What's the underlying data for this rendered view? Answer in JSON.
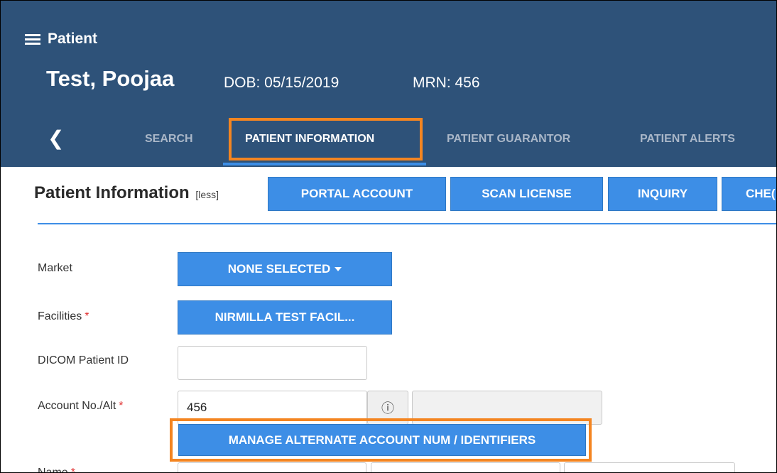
{
  "header": {
    "app_title": "Patient",
    "patient_name": "Test, Poojaa",
    "dob": "DOB: 05/15/2019",
    "mrn": "MRN: 456"
  },
  "tabs": [
    {
      "label": "SEARCH"
    },
    {
      "label": "PATIENT INFORMATION",
      "active": true
    },
    {
      "label": "PATIENT GUARANTOR"
    },
    {
      "label": "PATIENT ALERTS"
    }
  ],
  "section": {
    "title": "Patient Information",
    "less_link": "[less]",
    "actions": {
      "portal_account": "PORTAL ACCOUNT",
      "scan_license": "SCAN LICENSE",
      "inquiry": "INQUIRY",
      "check": "CHE("
    }
  },
  "form": {
    "market_label": "Market",
    "market_value": "NONE SELECTED",
    "facilities_label": "Facilities",
    "facilities_value": "NIRMILLA TEST FACIL...",
    "dicom_label": "DICOM Patient ID",
    "dicom_value": "",
    "account_label": "Account No./Alt",
    "account_value": "456",
    "alt_value": "",
    "manage_button": "MANAGE ALTERNATE ACCOUNT NUM / IDENTIFIERS",
    "name_label": "Name",
    "required_marker": "*"
  },
  "colors": {
    "header_bg": "#2e5279",
    "primary": "#3d8ee6",
    "highlight": "#f48521",
    "required": "#e03030"
  },
  "icons": {
    "menu": "hamburger-menu-icon",
    "back": "chevron-left-icon",
    "info": "info-circle-icon",
    "dropdown": "caret-down-icon"
  }
}
